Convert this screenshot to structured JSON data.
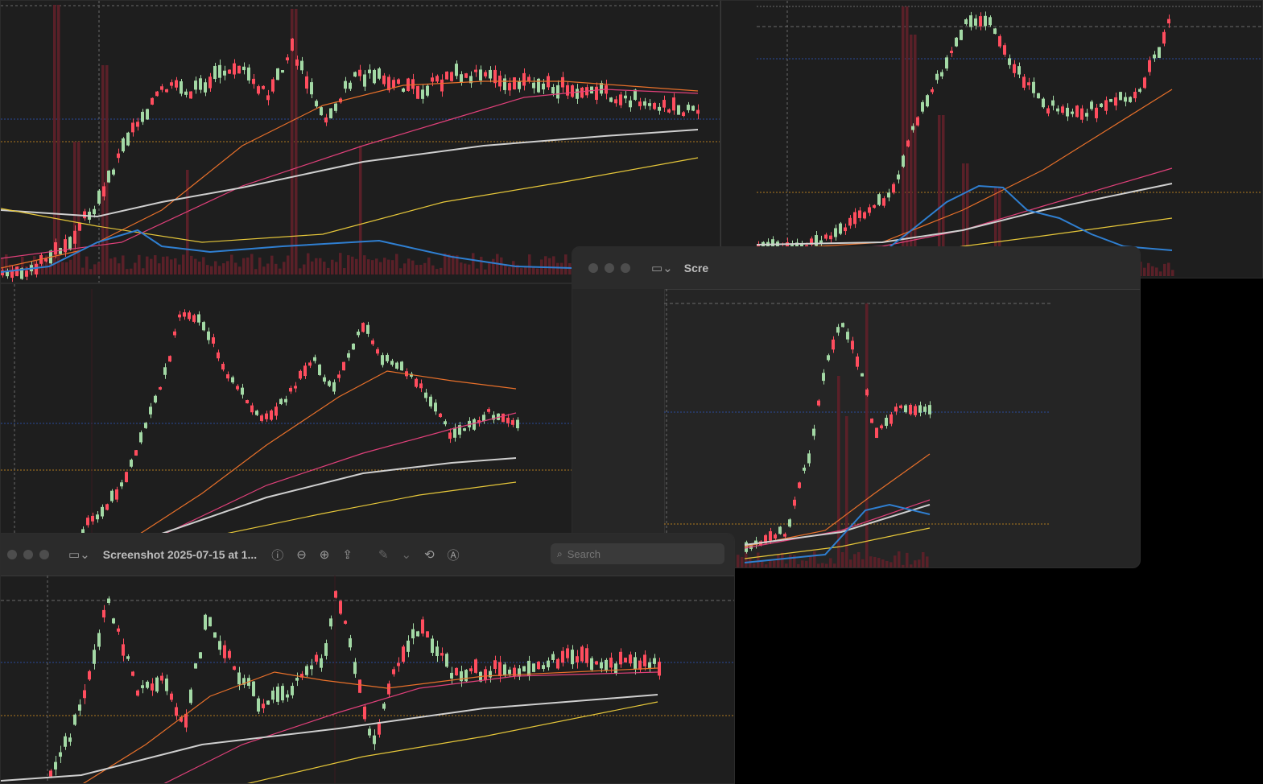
{
  "windows": {
    "bottom": {
      "title": "Screenshot 2025-07-15 at 1...",
      "search_placeholder": "Search"
    },
    "middle_right": {
      "title": "Scre"
    }
  },
  "colors": {
    "bull": "#a3d9a5",
    "bear": "#ff4d5e",
    "ema_orange": "#e8702a",
    "ema_pink": "#e0407a",
    "sma_white": "#cfcfcf",
    "sma_yellow": "#e6c73a",
    "vol_line": "#2f7fd1",
    "volume_bar": "#5a2028",
    "guide_blue": "#2a4a9a",
    "guide_orange": "#b07a20",
    "guide_white": "#6a6a6a"
  },
  "icons": {
    "sidebar": "sidebar-toggle-icon",
    "info": "info-icon",
    "zoom_out": "zoom-out-icon",
    "zoom_in": "zoom-in-icon",
    "share": "share-icon",
    "markup": "pencil-icon",
    "rotate": "rotate-icon",
    "annotate": "markup-icon",
    "search": "magnifier-icon"
  }
}
